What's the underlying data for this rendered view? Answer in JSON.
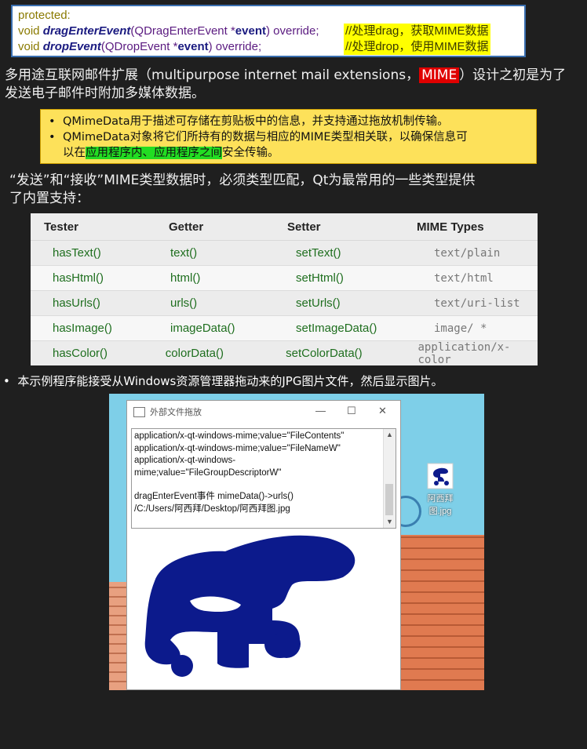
{
  "code": {
    "line1": "protected:",
    "line2": {
      "kw": "void",
      "fn": "dragEnterEvent",
      "ty": "(QDragEnterEvent *",
      "pm": "event",
      "rest": ") override;",
      "comment": "//处理drag，获取MIME数据"
    },
    "line3": {
      "kw": "void",
      "fn": "dropEvent",
      "ty": "(QDropEvent *",
      "pm": "event",
      "rest": ") override;",
      "comment": "//处理drop，使用MIME数据"
    }
  },
  "intro": {
    "p1a": "多用途互联网邮件扩展（multipurpose internet mail extensions，",
    "p1tag": "MIME",
    "p1b": "）设计之初是为了",
    "p2": "发送电子邮件时附加多媒体数据。"
  },
  "note": {
    "b1": "QMimeData用于描述可存储在剪贴板中的信息，并支持通过拖放机制传输。",
    "b2a": "QMimeData对象将它们所持有的数据与相应的MIME类型相关联，以确保信息可",
    "b2b_pre": "以在",
    "b2b_hl": "应用程序内、应用程序之间",
    "b2b_post": "安全传输。"
  },
  "para2": {
    "l1": "“发送”和“接收”MIME类型数据时，必须类型匹配，Qt为最常用的一些类型提供",
    "l2": "了内置支持："
  },
  "table": {
    "headers": [
      "Tester",
      "Getter",
      "Setter",
      "MIME Types"
    ],
    "rows": [
      [
        "hasText()",
        "text()",
        "setText()",
        "text/plain"
      ],
      [
        "hasHtml()",
        "html()",
        "setHtml()",
        "text/html"
      ],
      [
        "hasUrls()",
        "urls()",
        "setUrls()",
        "text/uri-list"
      ],
      [
        "hasImage()",
        "imageData()",
        "setImageData()",
        "image/ *"
      ],
      [
        "hasColor()",
        "colorData()",
        "setColorData()",
        "application/x-color"
      ]
    ]
  },
  "bullet2": "本示例程序能接受从Windows资源管理器拖动来的JPG图片文件，然后显示图片。",
  "dialog": {
    "title": "外部文件拖放",
    "minimize": "—",
    "maximize": "☐",
    "close": "✕",
    "text_lines": [
      "application/x-qt-windows-mime;value=\"FileContents\"",
      "application/x-qt-windows-mime;value=\"FileNameW\"",
      "application/x-qt-windows-",
      "mime;value=\"FileGroupDescriptorW\"",
      "",
      " dragEnterEvent事件 mimeData()->urls()",
      "/C:/Users/阿西拜/Desktop/阿西拜图.jpg"
    ]
  },
  "desktop_icon_label": "阿西拜图.jpg",
  "colors": {
    "accent_blue": "#3a6fb0",
    "logo_blue": "#0c1a8c",
    "note_yellow": "#fde15a",
    "mime_red": "#e00000"
  }
}
